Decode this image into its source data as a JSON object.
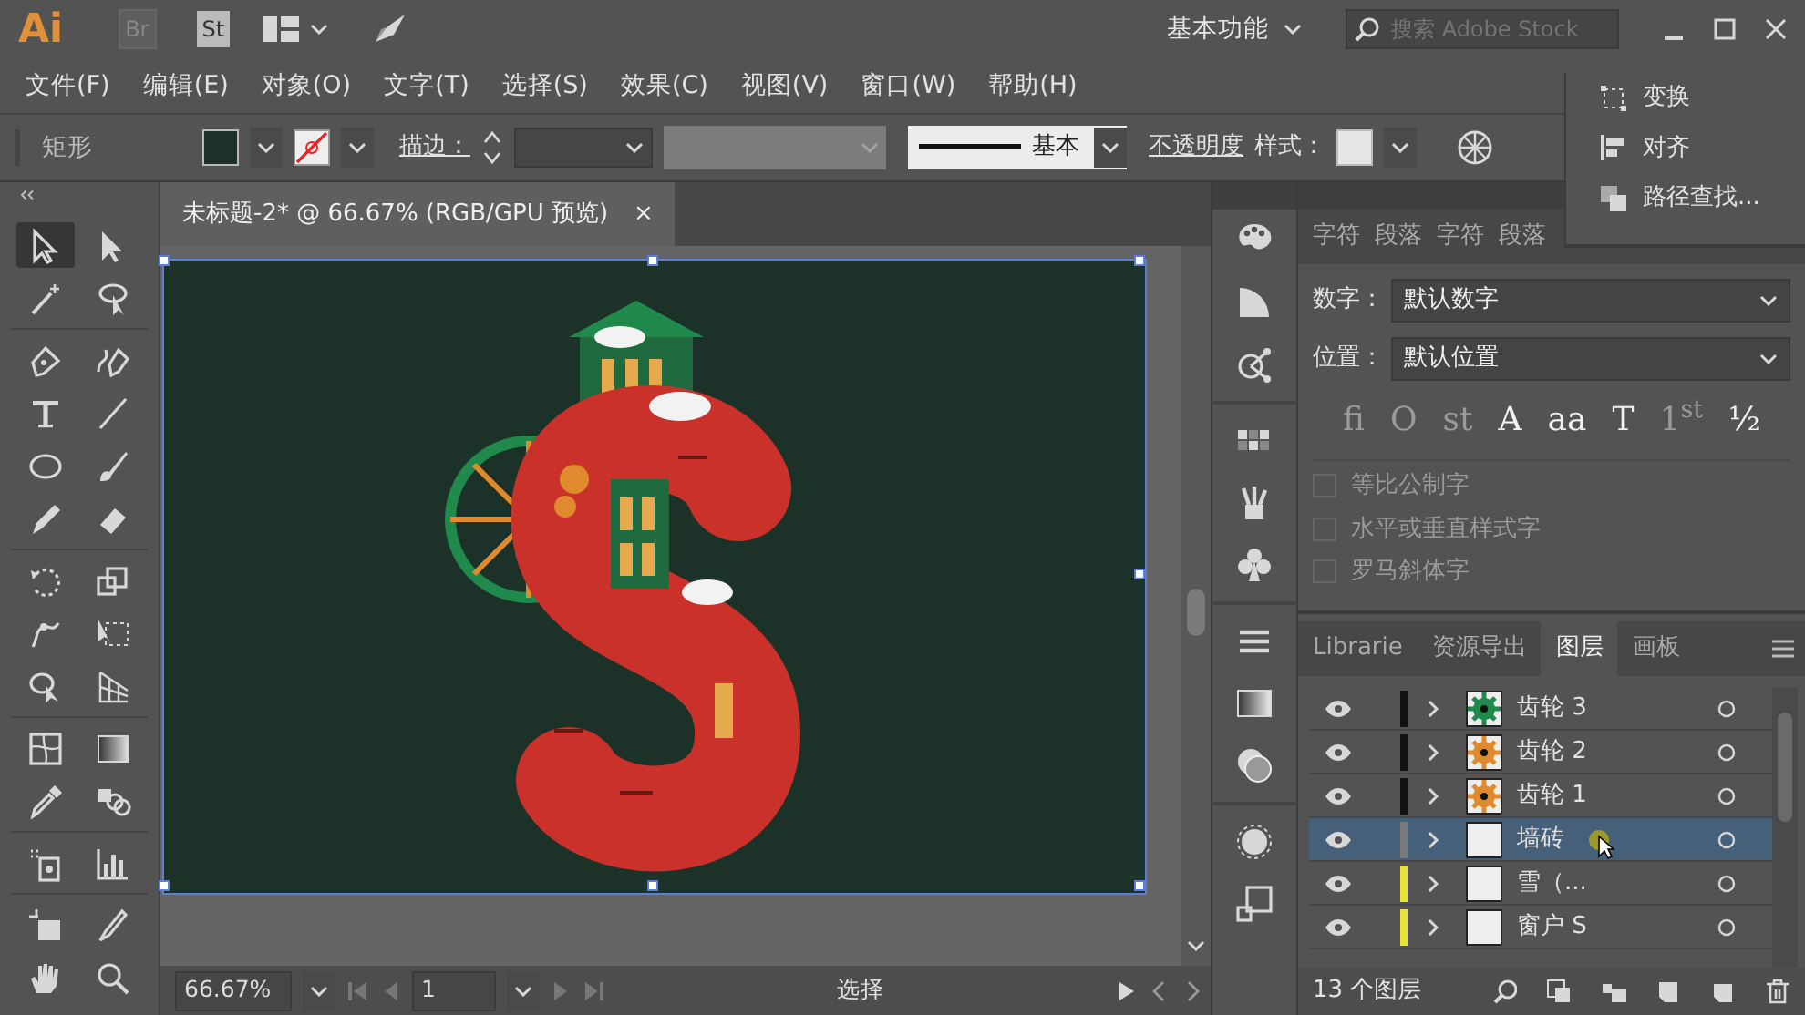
{
  "app_bar": {
    "logo": "Ai",
    "bridge": "Br",
    "stock": "St",
    "workspace": "基本功能",
    "search_placeholder": "搜索 Adobe Stock"
  },
  "menu": [
    "文件(F)",
    "编辑(E)",
    "对象(O)",
    "文字(T)",
    "选择(S)",
    "效果(C)",
    "视图(V)",
    "窗口(W)",
    "帮助(H)"
  ],
  "control_bar": {
    "tool_name": "矩形",
    "stroke_label": "描边：",
    "brush": "基本",
    "opacity_label": "不透明度",
    "style_label": "样式："
  },
  "floating_panel": {
    "items": [
      "变换",
      "对齐",
      "路径查找..."
    ]
  },
  "document_tab": {
    "title": "未标题-2* @ 66.67% (RGB/GPU 预览)",
    "close": "×"
  },
  "tools": [
    {
      "selected": true
    },
    {
      "selected": false
    },
    {
      "selected": false
    },
    {
      "selected": false
    },
    {
      "selected": false
    },
    {
      "selected": false
    },
    {
      "selected": false
    },
    {
      "selected": false
    },
    {
      "selected": false
    },
    {
      "selected": false
    },
    {
      "selected": false
    },
    {
      "selected": false
    },
    {
      "selected": false
    },
    {
      "selected": false
    },
    {
      "selected": false
    },
    {
      "selected": false
    },
    {
      "selected": false
    },
    {
      "selected": false
    },
    {
      "selected": false
    },
    {
      "selected": false
    },
    {
      "selected": false
    },
    {
      "selected": false
    },
    {
      "selected": false
    },
    {
      "selected": false
    },
    {
      "selected": false
    },
    {
      "selected": false
    },
    {
      "selected": false
    },
    {
      "selected": false
    }
  ],
  "status_bar": {
    "zoom": "66.67%",
    "page": "1",
    "current_tool": "选择"
  },
  "opentype_panel": {
    "tabs": [
      {
        "label": "字符",
        "selected": false
      },
      {
        "label": "段落",
        "selected": false
      },
      {
        "label": "字符",
        "selected": false
      },
      {
        "label": "段落",
        "selected": false
      }
    ],
    "number_label": "数字：",
    "number_value": "默认数字",
    "position_label": "位置：",
    "position_value": "默认位置",
    "glyphs": [
      {
        "text": "fi",
        "disabled": true
      },
      {
        "text": "O",
        "disabled": true
      },
      {
        "text": "st",
        "disabled": true
      },
      {
        "text": "A",
        "disabled": false
      },
      {
        "text": "aa",
        "disabled": false
      },
      {
        "text": "T",
        "disabled": false
      },
      {
        "text": "1$^{st}$",
        "disabled": true
      },
      {
        "text": "½",
        "disabled": false
      }
    ],
    "options": [
      {
        "label": "等比公制字",
        "checked": false,
        "disabled": true
      },
      {
        "label": "水平或垂直样式字",
        "checked": false,
        "disabled": true
      },
      {
        "label": "罗马斜体字",
        "checked": false,
        "disabled": true
      }
    ]
  },
  "layers_panel": {
    "tabs": [
      {
        "label": "Librarie",
        "selected": false
      },
      {
        "label": "资源导出",
        "selected": false
      },
      {
        "label": "图层",
        "selected": true
      },
      {
        "label": "画板",
        "selected": false
      }
    ],
    "layers": [
      {
        "name": "齿轮 3",
        "color": "#111111",
        "selected": false,
        "thumb": {
          "kind": "gear",
          "color": "#1f8a4c"
        }
      },
      {
        "name": "齿轮 2",
        "color": "#111111",
        "selected": false,
        "thumb": {
          "kind": "gear",
          "color": "#e08a2e"
        }
      },
      {
        "name": "齿轮 1",
        "color": "#111111",
        "selected": false,
        "thumb": {
          "kind": "gear",
          "color": "#e08a2e"
        }
      },
      {
        "name": "墙砖",
        "color": "#7a7a7a",
        "selected": true,
        "thumb": {
          "kind": "plain"
        }
      },
      {
        "name": "雪（...",
        "color": "#e6e23a",
        "selected": false,
        "thumb": {
          "kind": "plain"
        }
      },
      {
        "name": "窗户 S",
        "color": "#e6e23a",
        "selected": false,
        "thumb": {
          "kind": "plain"
        }
      }
    ],
    "count": "13 个图层"
  }
}
